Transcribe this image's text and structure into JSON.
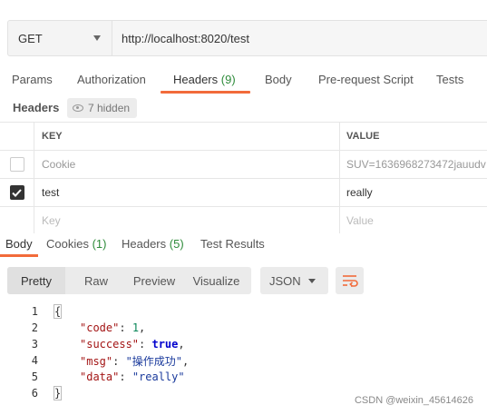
{
  "request": {
    "method": "GET",
    "url": "http://localhost:8020/test"
  },
  "request_tabs": [
    {
      "label": "Params"
    },
    {
      "label": "Authorization"
    },
    {
      "label": "Headers",
      "count": "(9)"
    },
    {
      "label": "Body"
    },
    {
      "label": "Pre-request Script"
    },
    {
      "label": "Tests"
    }
  ],
  "headers_section": {
    "title": "Headers",
    "hidden_label": "7 hidden"
  },
  "headers_table": {
    "columns": [
      "KEY",
      "VALUE"
    ],
    "rows": [
      {
        "key": "Cookie",
        "value": "SUV=1636968273472jauudv",
        "checked": false
      },
      {
        "key": "test",
        "value": "really",
        "checked": true
      }
    ],
    "key_placeholder": "Key",
    "value_placeholder": "Value"
  },
  "response_tabs": [
    {
      "label": "Body"
    },
    {
      "label": "Cookies",
      "count": "(1)"
    },
    {
      "label": "Headers",
      "count": "(5)"
    },
    {
      "label": "Test Results"
    }
  ],
  "body_toolbar": {
    "views": [
      "Pretty",
      "Raw",
      "Preview",
      "Visualize"
    ],
    "selected_view": "Pretty",
    "format": "JSON"
  },
  "response_body": {
    "line_numbers": [
      "1",
      "2",
      "3",
      "4",
      "5",
      "6"
    ],
    "open_brace": "{",
    "close_brace": "}",
    "fields": [
      {
        "key": "\"code\"",
        "value": "1",
        "type": "number"
      },
      {
        "key": "\"success\"",
        "value": "true",
        "type": "bool"
      },
      {
        "key": "\"msg\"",
        "value": "\"操作成功\"",
        "type": "string"
      },
      {
        "key": "\"data\"",
        "value": "\"really\"",
        "type": "string"
      }
    ]
  },
  "watermark": "CSDN @weixin_45614626",
  "colors": {
    "accent": "#f26b3a",
    "count_green": "#2e8b3a"
  }
}
